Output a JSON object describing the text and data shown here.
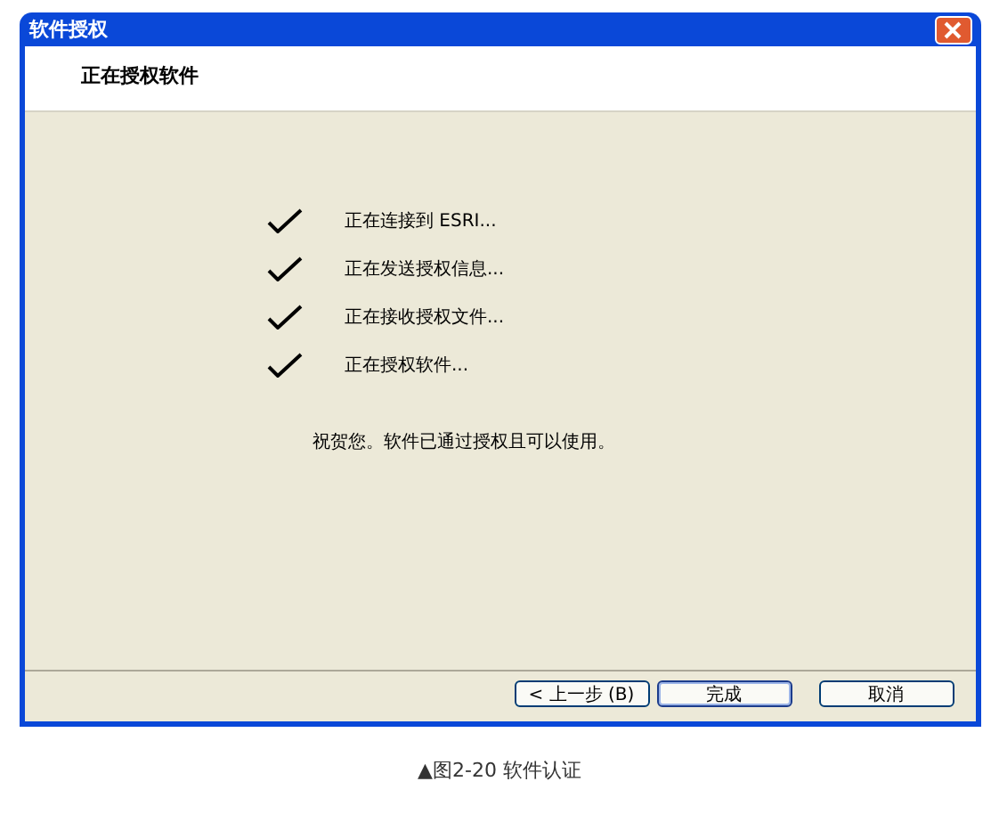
{
  "window": {
    "title": "软件授权"
  },
  "header": {
    "title": "正在授权软件"
  },
  "steps": [
    {
      "label": "正在连接到 ESRI...",
      "done": true
    },
    {
      "label": "正在发送授权信息...",
      "done": true
    },
    {
      "label": "正在接收授权文件...",
      "done": true
    },
    {
      "label": "正在授权软件...",
      "done": true
    }
  ],
  "message": "祝贺您。软件已通过授权且可以使用。",
  "buttons": [
    {
      "label": "< 上一步 (B)",
      "default": false
    },
    {
      "label": "完成",
      "default": true
    },
    {
      "label": "取消",
      "default": false
    }
  ],
  "caption": "▲图2-20 软件认证"
}
